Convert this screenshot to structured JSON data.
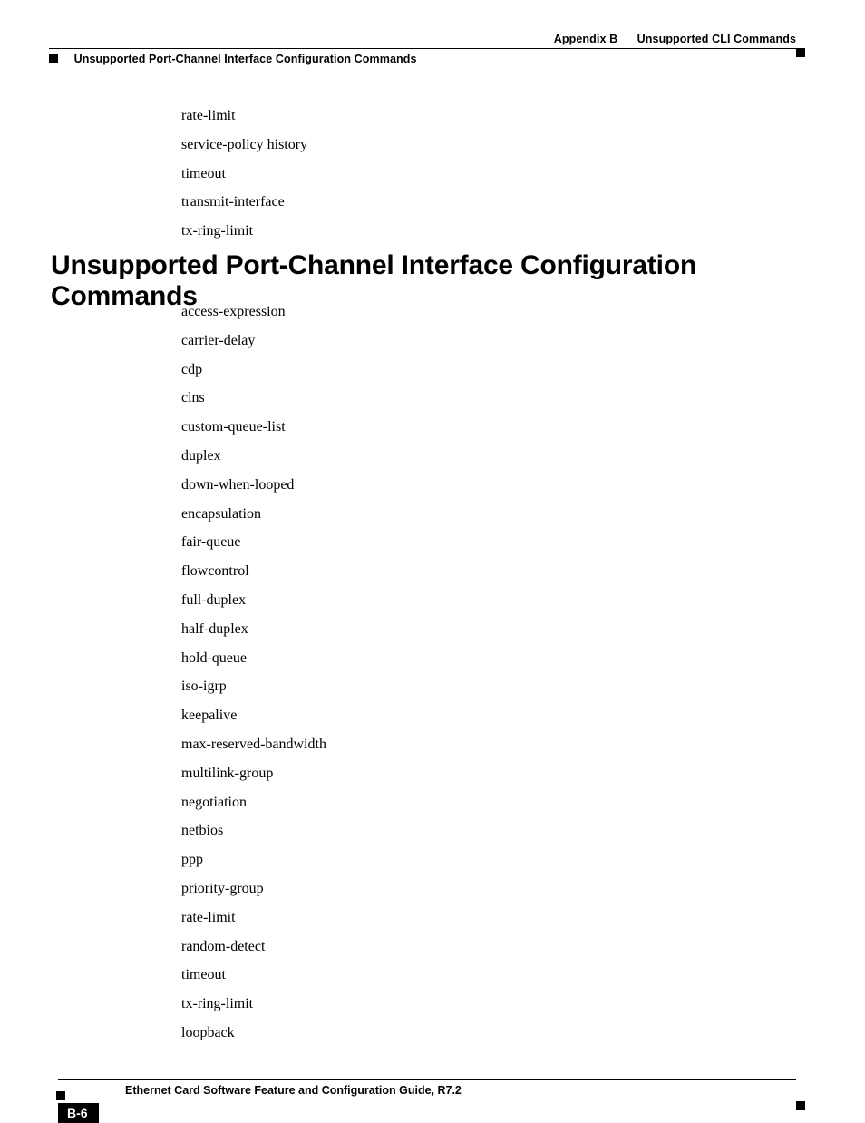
{
  "header": {
    "appendix_label": "Appendix B",
    "appendix_title": "Unsupported CLI Commands",
    "section_title_top": "Unsupported Port-Channel Interface Configuration Commands"
  },
  "top_commands": [
    "rate-limit",
    "service-policy history",
    "timeout",
    "transmit-interface",
    "tx-ring-limit"
  ],
  "section_heading": "Unsupported Port-Channel Interface Configuration Commands",
  "port_channel_commands": [
    "access-expression",
    "carrier-delay",
    "cdp",
    "clns",
    "custom-queue-list",
    "duplex",
    "down-when-looped",
    "encapsulation",
    "fair-queue",
    "flowcontrol",
    "full-duplex",
    "half-duplex",
    "hold-queue",
    "iso-igrp",
    "keepalive",
    "max-reserved-bandwidth",
    "multilink-group",
    "negotiation",
    "netbios",
    "ppp",
    "priority-group",
    "rate-limit",
    "random-detect",
    "timeout",
    "tx-ring-limit",
    "loopback"
  ],
  "footer": {
    "guide_title": "Ethernet Card Software Feature and Configuration Guide, R7.2",
    "page_number": "B-6"
  }
}
